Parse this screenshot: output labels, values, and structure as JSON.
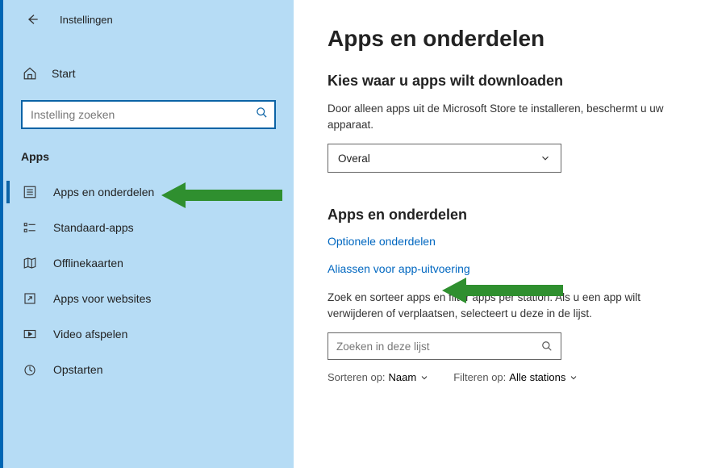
{
  "header": {
    "title": "Instellingen"
  },
  "sidebar": {
    "home_label": "Start",
    "search_placeholder": "Instelling zoeken",
    "category_label": "Apps",
    "items": [
      {
        "label": "Apps en onderdelen"
      },
      {
        "label": "Standaard-apps"
      },
      {
        "label": "Offlinekaarten"
      },
      {
        "label": "Apps voor websites"
      },
      {
        "label": "Video afspelen"
      },
      {
        "label": "Opstarten"
      }
    ]
  },
  "main": {
    "title": "Apps en onderdelen",
    "section1": {
      "heading": "Kies waar u apps wilt downloaden",
      "body": "Door alleen apps uit de Microsoft Store te installeren, beschermt u uw apparaat.",
      "dropdown_value": "Overal"
    },
    "section2": {
      "heading": "Apps en onderdelen",
      "link1": "Optionele onderdelen",
      "link2": "Aliassen voor app-uitvoering",
      "body": "Zoek en sorteer apps en filter apps per station. Als u een app wilt verwijderen of verplaatsen, selecteert u deze in de lijst.",
      "search_placeholder": "Zoeken in deze lijst",
      "sort_label": "Sorteren op:",
      "sort_value": "Naam",
      "filter_label": "Filteren op:",
      "filter_value": "Alle stations"
    }
  }
}
